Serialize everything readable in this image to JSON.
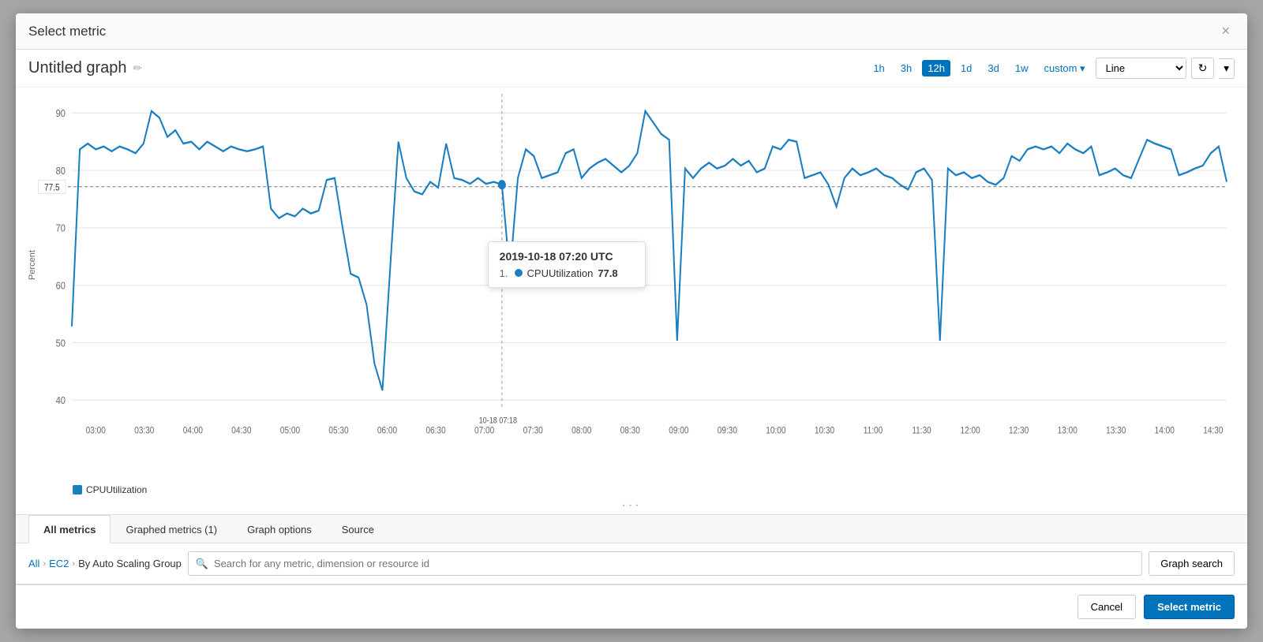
{
  "modal": {
    "title": "Select metric",
    "close_label": "×"
  },
  "graph": {
    "title": "Untitled graph",
    "edit_icon": "✏",
    "y_axis_label": "Percent",
    "y_ticks": [
      "90",
      "80",
      "70",
      "60",
      "50",
      "40"
    ],
    "x_ticks": [
      "03:00",
      "03:30",
      "04:00",
      "04:30",
      "05:00",
      "05:30",
      "06:00",
      "06:30",
      "07:00",
      "07:30",
      "08:00",
      "08:30",
      "09:00",
      "09:30",
      "10:00",
      "10:30",
      "11:00",
      "11:30",
      "12:00",
      "12:30",
      "13:00",
      "13:30",
      "14:00",
      "14:30"
    ],
    "crosshair_label": "10-18 07:18",
    "tooltip": {
      "time": "2019-10-18 07:20 UTC",
      "row_number": "1.",
      "metric_name": "CPUUtilization",
      "value": "77.8"
    },
    "legend": {
      "label": "CPUUtilization"
    },
    "reference_line": "77.5",
    "controls": {
      "time_options": [
        "1h",
        "3h",
        "12h",
        "1d",
        "3d",
        "1w",
        "custom ▾"
      ],
      "active_time": "12h",
      "chart_type": "Line",
      "refresh_icon": "↻"
    }
  },
  "tabs": [
    {
      "label": "All metrics",
      "active": true
    },
    {
      "label": "Graphed metrics (1)",
      "active": false
    },
    {
      "label": "Graph options",
      "active": false
    },
    {
      "label": "Source",
      "active": false
    }
  ],
  "search_bar": {
    "breadcrumb": [
      "All",
      "EC2",
      "By Auto Scaling Group"
    ],
    "search_placeholder": "Search for any metric, dimension or resource id",
    "search_button_label": "Graph search"
  },
  "footer": {
    "cancel_label": "Cancel",
    "select_label": "Select metric"
  }
}
